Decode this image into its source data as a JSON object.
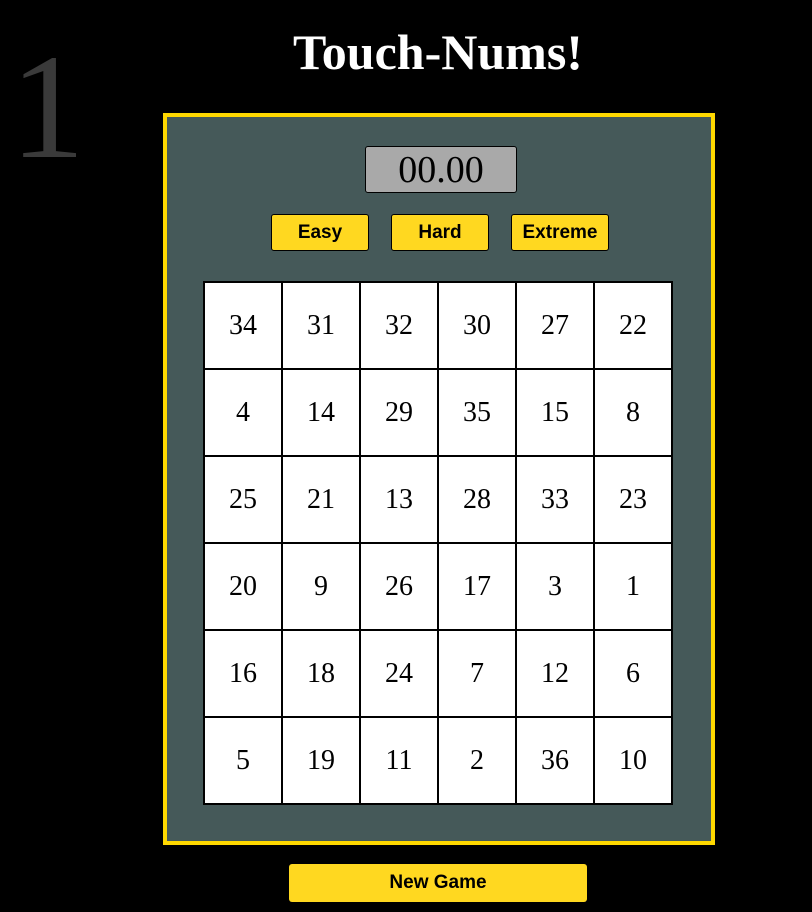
{
  "next_number": "1",
  "title": "Touch-Nums!",
  "timer": "00.00",
  "difficulty_buttons": [
    {
      "label": "Easy"
    },
    {
      "label": "Hard"
    },
    {
      "label": "Extreme"
    }
  ],
  "grid": [
    [
      "34",
      "31",
      "32",
      "30",
      "27",
      "22"
    ],
    [
      "4",
      "14",
      "29",
      "35",
      "15",
      "8"
    ],
    [
      "25",
      "21",
      "13",
      "28",
      "33",
      "23"
    ],
    [
      "20",
      "9",
      "26",
      "17",
      "3",
      "1"
    ],
    [
      "16",
      "18",
      "24",
      "7",
      "12",
      "6"
    ],
    [
      "5",
      "19",
      "11",
      "2",
      "36",
      "10"
    ]
  ],
  "new_game_label": "New Game",
  "colors": {
    "background": "#000000",
    "board": "#455959",
    "accent": "#ffd800",
    "timer_bg": "#a9a9a9",
    "ghost_number": "#3a3a3a"
  }
}
